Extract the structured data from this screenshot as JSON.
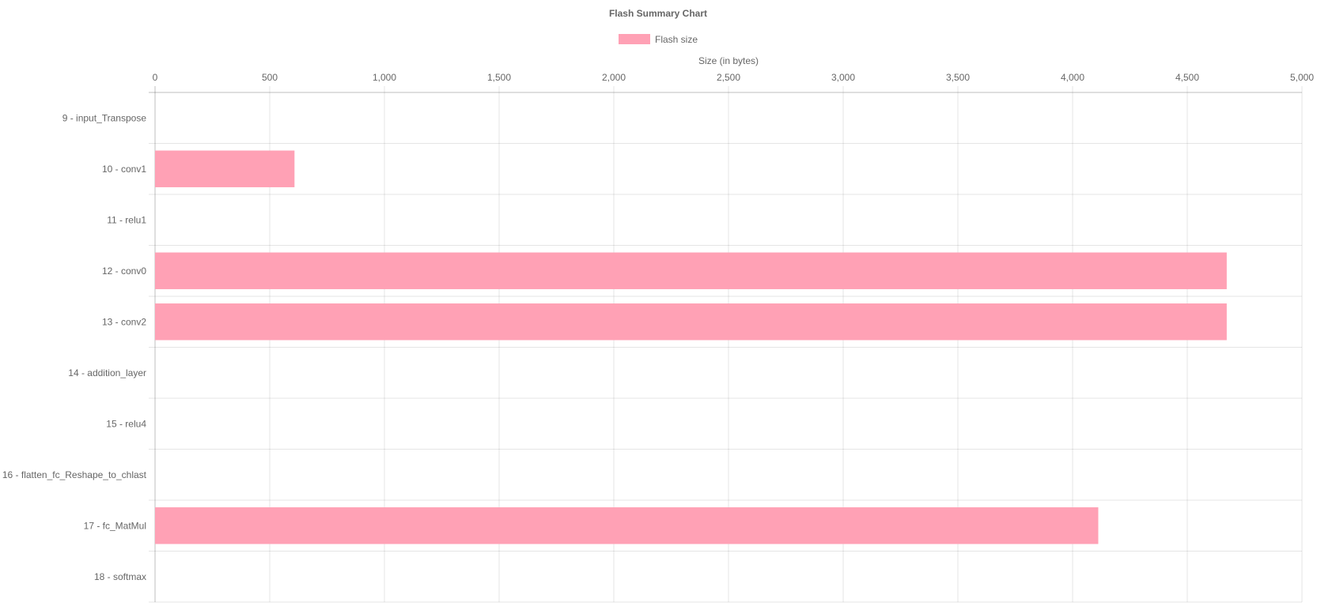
{
  "chart_data": {
    "type": "bar",
    "orientation": "horizontal",
    "title": "Flash Summary Chart",
    "xlabel": "Size (in bytes)",
    "ylabel": "",
    "xlim": [
      0,
      5000
    ],
    "xticks": [
      "0",
      "500",
      "1,000",
      "1,500",
      "2,000",
      "2,500",
      "3,000",
      "3,500",
      "4,000",
      "4,500",
      "5,000"
    ],
    "categories": [
      "9 - input_Transpose",
      "10 - conv1",
      "11 - relu1",
      "12 - conv0",
      "13 - conv2",
      "14 - addition_layer",
      "15 - relu4",
      "16 - flatten_fc_Reshape_to_chlast",
      "17 - fc_MatMul",
      "18 - softmax"
    ],
    "series": [
      {
        "name": "Flash size",
        "values": [
          0,
          608,
          0,
          4672,
          4672,
          0,
          0,
          0,
          4112,
          0
        ],
        "color": "#ffa1b5"
      }
    ],
    "grid": true,
    "legend_position": "top-center",
    "axis_position": "top"
  }
}
